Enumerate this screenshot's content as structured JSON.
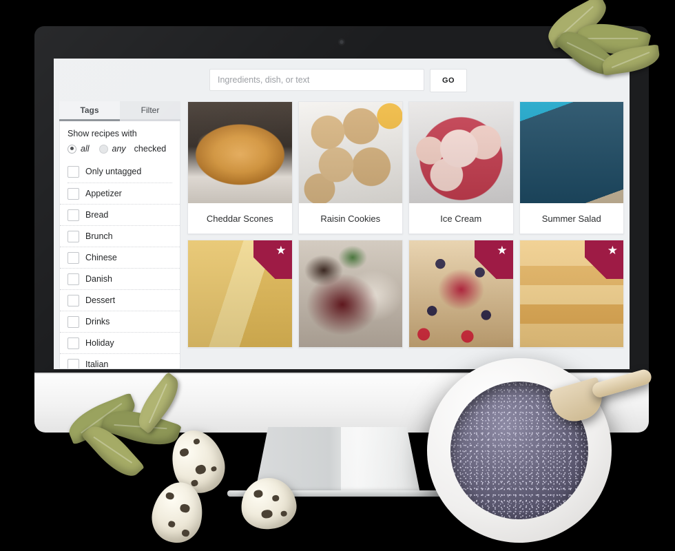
{
  "app": {
    "device": "desktop-monitor-mockup"
  },
  "search": {
    "placeholder": "Ingredients, dish, or text",
    "value": "",
    "go_label": "GO"
  },
  "sidebar": {
    "tabs": [
      {
        "label": "Tags",
        "active": true
      },
      {
        "label": "Filter",
        "active": false
      }
    ],
    "filter_heading": "Show recipes with",
    "match_options": [
      {
        "label": "all",
        "selected": true
      },
      {
        "label": "any",
        "selected": false
      }
    ],
    "match_suffix": "checked",
    "only_untagged": {
      "label": "Only untagged",
      "checked": false
    },
    "tags": [
      {
        "label": "Appetizer",
        "checked": false
      },
      {
        "label": "Bread",
        "checked": false
      },
      {
        "label": "Brunch",
        "checked": false
      },
      {
        "label": "Chinese",
        "checked": false
      },
      {
        "label": "Danish",
        "checked": false
      },
      {
        "label": "Dessert",
        "checked": false
      },
      {
        "label": "Drinks",
        "checked": false
      },
      {
        "label": "Holiday",
        "checked": false
      },
      {
        "label": "Italian",
        "checked": false
      }
    ]
  },
  "grid": {
    "recipes": [
      {
        "title": "Cheddar Scones",
        "art": "a-scone",
        "starred": false,
        "image_alt": "cheddar scone on white paper"
      },
      {
        "title": "Raisin Cookies",
        "art": "a-cookies",
        "starred": false,
        "image_alt": "plate of raisin cookies"
      },
      {
        "title": "Ice Cream",
        "art": "a-icecream",
        "starred": false,
        "image_alt": "pink ice cream scoops in red bowl"
      },
      {
        "title": "Summer Salad",
        "art": "a-salad",
        "starred": false,
        "image_alt": "zucchini noodle salad on teal tray"
      },
      {
        "title": "",
        "art": "a-pasta",
        "starred": true,
        "image_alt": "pasta with garlic tomato and basil"
      },
      {
        "title": "",
        "art": "a-choc",
        "starred": false,
        "image_alt": "cookies and cream dessert with chocolate sauce"
      },
      {
        "title": "",
        "art": "a-berry",
        "starred": true,
        "image_alt": "mixed berry fruit tart"
      },
      {
        "title": "",
        "art": "a-pancake",
        "starred": true,
        "image_alt": "pancake stack with berries and syrup"
      }
    ],
    "star_glyph": "★"
  },
  "colors": {
    "bezel": "#1c1d1f",
    "screen_bg": "#eef0f2",
    "card_bg": "#ffffff",
    "star_ribbon": "#9e1b45",
    "tab_active_underline": "#8d9298",
    "placeholder_text": "#9b9ea3"
  }
}
